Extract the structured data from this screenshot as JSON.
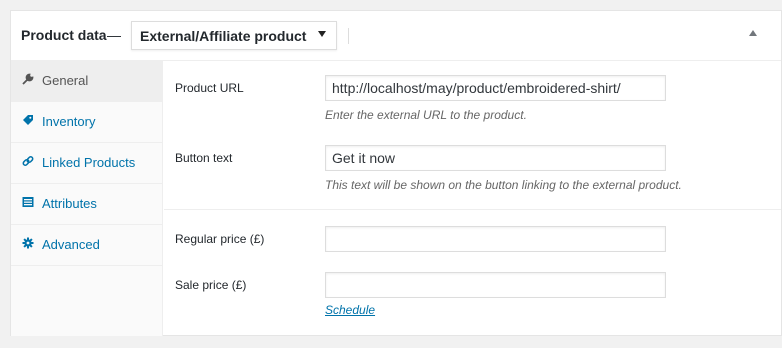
{
  "header": {
    "title": "Product data",
    "dash": "—",
    "product_type": "External/Affiliate product"
  },
  "tabs": [
    {
      "label": "General",
      "icon": "wrench-icon"
    },
    {
      "label": "Inventory",
      "icon": "tag-icon"
    },
    {
      "label": "Linked Products",
      "icon": "link-icon"
    },
    {
      "label": "Attributes",
      "icon": "list-icon"
    },
    {
      "label": "Advanced",
      "icon": "gear-icon"
    }
  ],
  "general": {
    "product_url": {
      "label": "Product URL",
      "value": "http://localhost/may/product/embroidered-shirt/",
      "description": "Enter the external URL to the product."
    },
    "button_text": {
      "label": "Button text",
      "value": "Get it now",
      "description": "This text will be shown on the button linking to the external product."
    },
    "regular_price": {
      "label": "Regular price (£)",
      "value": ""
    },
    "sale_price": {
      "label": "Sale price (£)",
      "value": ""
    },
    "schedule_link": "Schedule"
  },
  "colors": {
    "link": "#0073aa",
    "active_tab_bg": "#eeeeee"
  }
}
